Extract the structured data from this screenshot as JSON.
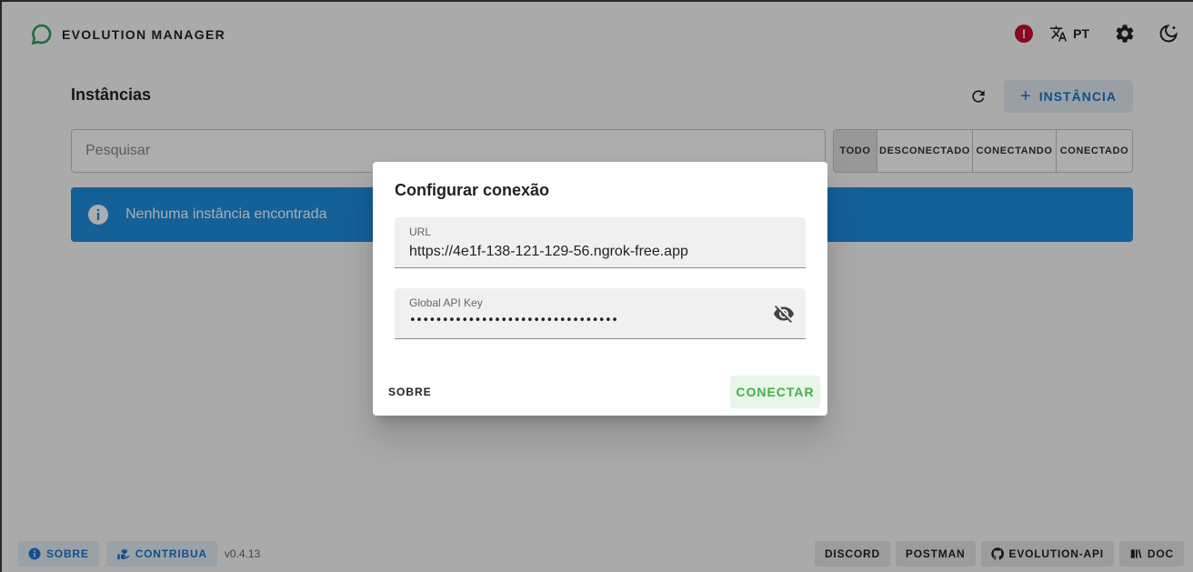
{
  "header": {
    "brand": "EVOLUTION MANAGER",
    "alert_icon": "!",
    "language": "PT"
  },
  "main": {
    "title": "Instâncias",
    "add_button": "INSTÂNCIA",
    "search_placeholder": "Pesquisar",
    "filters": [
      "TODO",
      "DESCONECTADO",
      "CONECTANDO",
      "CONECTADO"
    ],
    "active_filter": "TODO",
    "info_message": "Nenhuma instância encontrada"
  },
  "footer": {
    "sobre": "SOBRE",
    "contribua": "CONTRIBUA",
    "version": "v0.4.13",
    "discord": "DISCORD",
    "postman": "POSTMAN",
    "github": "EVOLUTION-API",
    "doc": "DOC"
  },
  "dialog": {
    "title": "Configurar conexão",
    "url_label": "URL",
    "url_value": "https://4e1f-138-121-129-56.ngrok-free.app",
    "key_label": "Global API Key",
    "key_value": "••••••••••••••••••••••••••••••••",
    "sobre_button": "SOBRE",
    "connect_button": "CONECTAR"
  },
  "colors": {
    "primary": "#1976d2",
    "info_bg": "#1e8ee0",
    "success": "#43b047",
    "alert": "#c8102e",
    "logo": "#2e9e5b"
  }
}
